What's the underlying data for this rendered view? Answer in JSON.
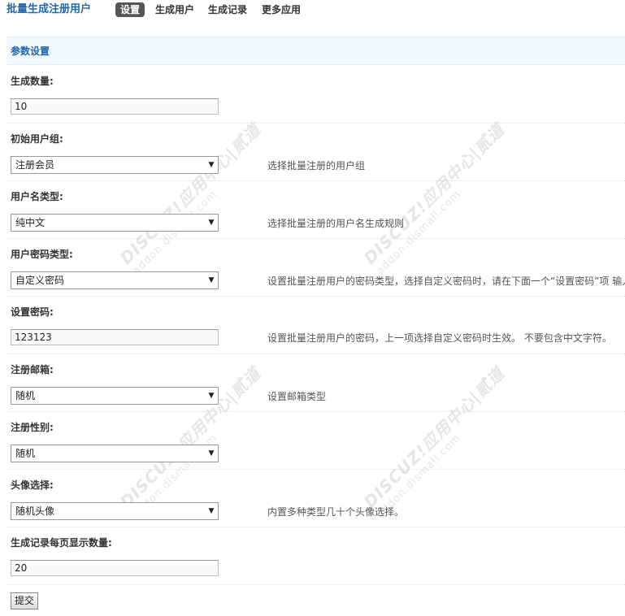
{
  "header": {
    "app_title": "批量生成注册用户",
    "tabs": [
      {
        "label": "设置",
        "active": true
      },
      {
        "label": "生成用户",
        "active": false
      },
      {
        "label": "生成记录",
        "active": false
      },
      {
        "label": "更多应用",
        "active": false
      }
    ]
  },
  "section": {
    "title": "参数设置"
  },
  "form": {
    "count": {
      "label": "生成数量:",
      "value": "10"
    },
    "group": {
      "label": "初始用户组:",
      "value": "注册会员",
      "hint": "选择批量注册的用户组"
    },
    "username_type": {
      "label": "用户名类型:",
      "value": "纯中文",
      "hint": "选择批量注册的用户名生成规则"
    },
    "password_type": {
      "label": "用户密码类型:",
      "value": "自定义密码",
      "hint": "设置批量注册用户的密码类型，选择自定义密码时，请在下面一个“设置密码”项 输入"
    },
    "password": {
      "label": "设置密码:",
      "value": "123123",
      "hint": "设置批量注册用户的密码，上一项选择自定义密码时生效。 不要包含中文字符。"
    },
    "email": {
      "label": "注册邮箱:",
      "value": "随机",
      "hint": "设置邮箱类型"
    },
    "gender": {
      "label": "注册性别:",
      "value": "随机"
    },
    "avatar": {
      "label": "头像选择:",
      "value": "随机头像",
      "hint": "内置多种类型几十个头像选择。"
    },
    "page_size": {
      "label": "生成记录每页显示数量:",
      "value": "20"
    },
    "submit_label": "提交"
  },
  "watermark": {
    "brand": "DISCUZ!应用中心|贰道",
    "url": "addon.dismall.com"
  },
  "colors": {
    "accent": "#2366a8",
    "active_tab_bg": "#555555",
    "section_bg": "#f2f9fd"
  }
}
